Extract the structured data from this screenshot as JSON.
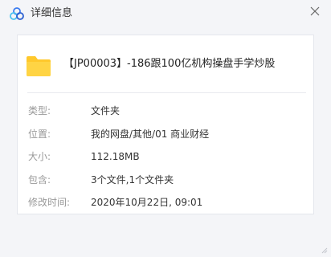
{
  "window": {
    "title": "详细信息"
  },
  "file": {
    "name": "【JP00003】-186跟100亿机构操盘手学炒股",
    "icon": "folder-icon"
  },
  "details": [
    {
      "label": "类型:",
      "value": "文件夹"
    },
    {
      "label": "位置:",
      "value": "我的网盘/其他/01 商业财经"
    },
    {
      "label": "大小:",
      "value": "112.18MB"
    },
    {
      "label": "包含:",
      "value": "3个文件,1个文件夹"
    },
    {
      "label": "修改时间:",
      "value": "2020年10月22日, 09:01"
    }
  ],
  "colors": {
    "background": "#f4f5f8",
    "folder": "#ffc82c",
    "label": "#999999",
    "value": "#333333"
  }
}
